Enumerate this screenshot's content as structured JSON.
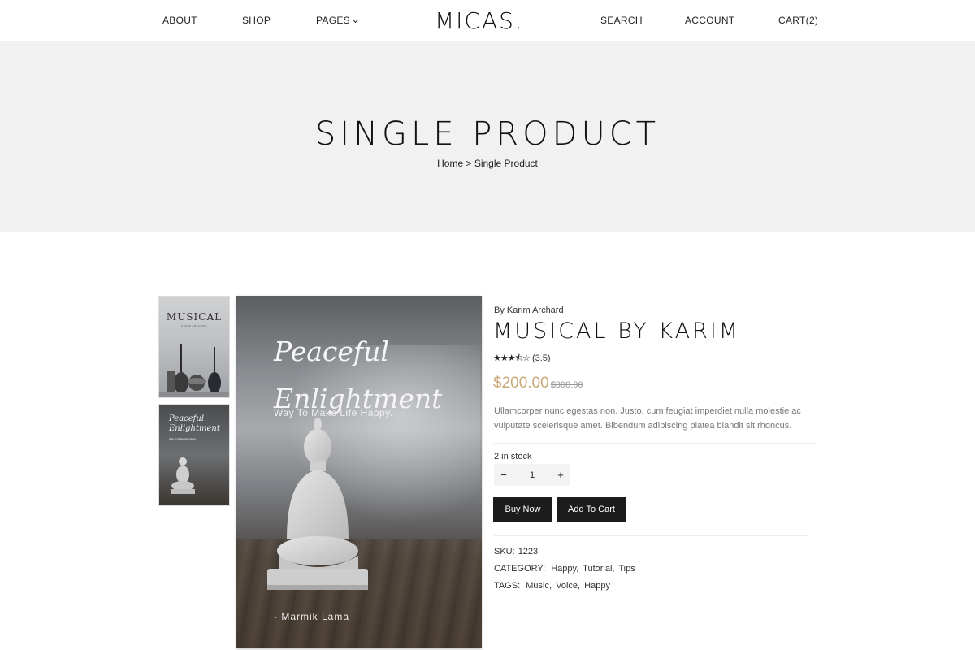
{
  "header": {
    "nav_left": {
      "about": "ABOUT",
      "shop": "SHOP",
      "pages": "PAGES"
    },
    "logo": "MICAS.",
    "nav_right": {
      "search": "SEARCH",
      "account": "ACCOUNT",
      "cart": "CART(2)"
    }
  },
  "hero": {
    "title": "SINGLE PRODUCT",
    "breadcrumb": {
      "home": "Home",
      "separator": " > ",
      "current": "Single Product"
    }
  },
  "gallery": {
    "thumb1": {
      "title": "MUSICAL",
      "subtitle": "KARIM ARCHARD"
    },
    "thumb2": {
      "title": "Peaceful Enlightment",
      "subtitle": "Way To Make Life Happy."
    },
    "main": {
      "title_line1": "Peaceful",
      "title_line2": "Enlightment",
      "tagline": "Way To Make Life Happy.",
      "author": "- Marmik Lama"
    }
  },
  "product": {
    "by": "By Karim Archard",
    "title": "MUSICAL BY KARIM",
    "rating": {
      "value": 3.5,
      "text": "(3.5)",
      "stars": "★★★⯪☆"
    },
    "price": "$200.00",
    "old_price": "$300.00",
    "description": "Ullamcorper nunc egestas non. Justo, cum feugiat imperdiet nulla molestie ac vulputate scelerisque amet. Bibendum adipiscing platea blandit sit rhoncus.",
    "stock": "2 in stock",
    "quantity": {
      "minus": "−",
      "value": "1",
      "plus": "+"
    },
    "buy_now": "Buy Now",
    "add_to_cart": "Add To Cart",
    "sku": {
      "label": "SKU:",
      "value": "1223"
    },
    "category": {
      "label": "CATEGORY:",
      "items": [
        "Happy,",
        "Tutorial,",
        "Tips"
      ]
    },
    "tags": {
      "label": "TAGS:",
      "items": [
        "Music,",
        "Voice,",
        "Happy"
      ]
    }
  },
  "colors": {
    "price": "#c9a876",
    "button_bg": "#1c1c1c",
    "hero_bg": "#f1f1f1"
  }
}
